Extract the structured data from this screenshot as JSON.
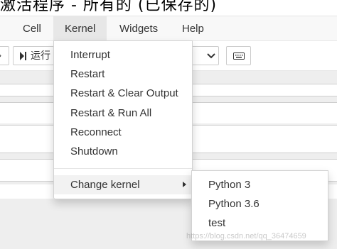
{
  "title": {
    "text": "激活程序 - 所有的 (已保存的)"
  },
  "menubar": {
    "items": [
      {
        "label": "Cell",
        "name": "menu-cell"
      },
      {
        "label": "Kernel",
        "name": "menu-kernel"
      },
      {
        "label": "Widgets",
        "name": "menu-widgets"
      },
      {
        "label": "Help",
        "name": "menu-help"
      }
    ]
  },
  "toolbar": {
    "run_label": "运行",
    "keyboard_icon": "keyboard-icon"
  },
  "kernel_menu": {
    "items": [
      "Interrupt",
      "Restart",
      "Restart & Clear Output",
      "Restart & Run All",
      "Reconnect",
      "Shutdown"
    ],
    "change_kernel_label": "Change kernel"
  },
  "change_kernel_submenu": {
    "items": [
      "Python 3",
      "Python 3.6",
      "test"
    ]
  },
  "watermark": "https://blog.csdn.net/qq_36474659"
}
